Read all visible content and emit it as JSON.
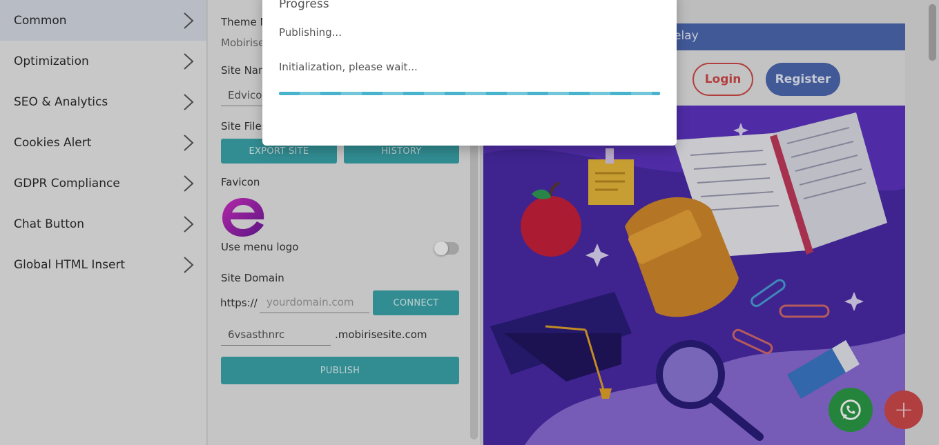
{
  "sidebar": {
    "items": [
      {
        "label": "Common",
        "active": true
      },
      {
        "label": "Optimization"
      },
      {
        "label": "SEO & Analytics"
      },
      {
        "label": "Cookies Alert"
      },
      {
        "label": "GDPR Compliance"
      },
      {
        "label": "Chat Button"
      },
      {
        "label": "Global HTML Insert"
      }
    ]
  },
  "panel": {
    "theme_label": "Theme N",
    "theme_value": "Mobirise",
    "site_name_label": "Site Nam",
    "site_name_value": "Edvicon",
    "site_files_label": "Site Files",
    "export_button": "EXPORT SITE",
    "history_button": "HISTORY",
    "favicon_label": "Favicon",
    "use_menu_logo_label": "Use menu logo",
    "use_menu_logo_on": false,
    "site_domain_label": "Site Domain",
    "https_prefix": "https://",
    "domain_placeholder": "yourdomain.com",
    "connect_button": "CONNECT",
    "subdomain_value": "6vsasthnrc",
    "subdomain_suffix": ".mobirisesite.com",
    "publish_button": "PUBLISH"
  },
  "preview": {
    "topbar_text": "elay",
    "login_button": "Login",
    "register_button": "Register",
    "fab_plus": "+"
  },
  "dialog": {
    "title": "Progress",
    "status": "Publishing...",
    "message": "Initialization, please wait...",
    "progress": 1.0
  },
  "colors": {
    "accent": "#3aa5aa",
    "brand_blue": "#4c68b0",
    "login_red": "#d04a48",
    "whatsapp_green": "#2c9a46",
    "progress_blue": "#48b3cd"
  }
}
